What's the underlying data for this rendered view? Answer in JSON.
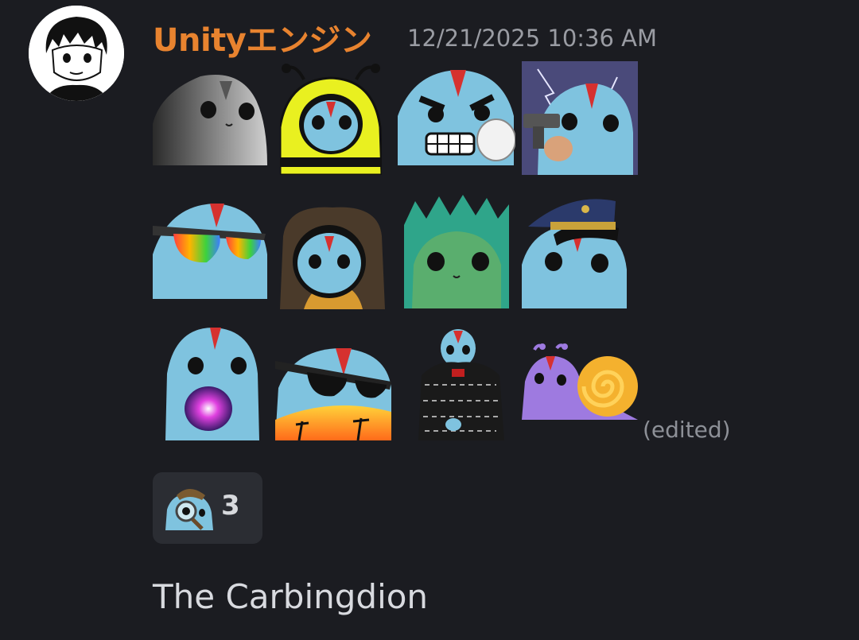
{
  "message": {
    "username": "Unityエンジン",
    "timestamp": "12/21/2025 10:36 AM",
    "edited_label": "(edited)",
    "text": "The Carbingdion"
  },
  "emojis": [
    {
      "name": "gray-seal-emoji"
    },
    {
      "name": "bee-costume-emoji"
    },
    {
      "name": "angry-fist-emoji"
    },
    {
      "name": "gun-lightning-emoji"
    },
    {
      "name": "rainbow-sunglasses-emoji"
    },
    {
      "name": "teddy-hood-emoji"
    },
    {
      "name": "green-leaf-emoji"
    },
    {
      "name": "pilot-hat-emoji"
    },
    {
      "name": "crystal-ball-emoji"
    },
    {
      "name": "sunset-sunglasses-emoji"
    },
    {
      "name": "jacket-standing-emoji"
    },
    {
      "name": "snail-emoji"
    }
  ],
  "reaction": {
    "emoji": "detective-magnifier-emoji",
    "count": "3"
  },
  "colors": {
    "background": "#1b1c21",
    "username": "#e8832f",
    "timestamp": "#9a9ca3",
    "mascot_blue": "#7fc3df",
    "mascot_red_stripe": "#d6312f",
    "reaction_bg": "#2b2d33"
  }
}
